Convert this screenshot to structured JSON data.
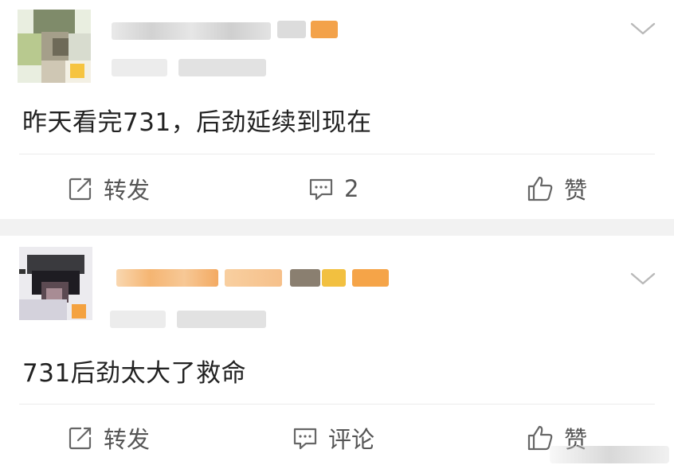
{
  "posts": [
    {
      "content": "昨天看完731，后劲延续到现在",
      "actions": {
        "repost_label": "转发",
        "comment_label": "2",
        "like_label": "赞"
      }
    },
    {
      "content": "731后劲太大了救命",
      "actions": {
        "repost_label": "转发",
        "comment_label": "评论",
        "like_label": "赞"
      }
    }
  ],
  "icons": {
    "repost": "repost-icon",
    "comment": "comment-icon",
    "like": "thumbs-up-icon",
    "more": "chevron-down-icon"
  },
  "colors": {
    "text": "#222222",
    "action_text": "#555555",
    "separator": "#f2f2f2",
    "username_blur_accent": "#f5a040"
  }
}
